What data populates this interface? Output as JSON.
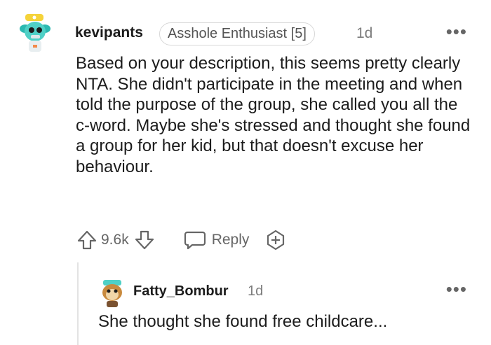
{
  "comment": {
    "username": "kevipants",
    "flair": "Asshole Enthusiast [5]",
    "time": "1d",
    "more_glyph": "•••",
    "body": "Based on your description, this seems pretty clearly NTA. She didn't participate in the meeting and when told the purpose of the group, she called you all the c-word. Maybe she's stressed and thought she found a group for her kid, but that doesn't excuse her behaviour.",
    "vote_count": "9.6k",
    "reply_label": "Reply",
    "icons": [
      "upvote-icon",
      "downvote-icon",
      "reply-bubble-icon",
      "add-award-icon",
      "more-options-icon"
    ]
  },
  "reply": {
    "username": "Fatty_Bombur",
    "time": "1d",
    "more_glyph": "•••",
    "body": "She thought she found free childcare..."
  },
  "colors": {
    "text": "#1c1c1c",
    "meta": "#7c7c7c",
    "icon": "#666666",
    "flair_border": "#d7d7d7",
    "thread_line": "#e3e3e3"
  }
}
